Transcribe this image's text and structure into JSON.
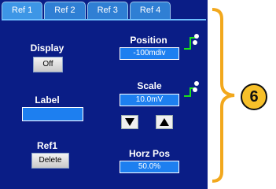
{
  "tabs": [
    "Ref 1",
    "Ref 2",
    "Ref 3",
    "Ref 4"
  ],
  "display": {
    "label": "Display",
    "button": "Off"
  },
  "label_section": {
    "label": "Label",
    "value": ""
  },
  "ref": {
    "label": "Ref1",
    "button": "Delete"
  },
  "position": {
    "label": "Position",
    "value": "-100mdiv"
  },
  "scale": {
    "label": "Scale",
    "value": "10.0mV"
  },
  "horz_pos": {
    "label": "Horz Pos",
    "value": "50.0%"
  },
  "callout": "6",
  "colors": {
    "panel": "#0a1d86",
    "field": "#1d7ff0",
    "tab": "#2f7fd4",
    "bracket": "#f2a81d"
  }
}
